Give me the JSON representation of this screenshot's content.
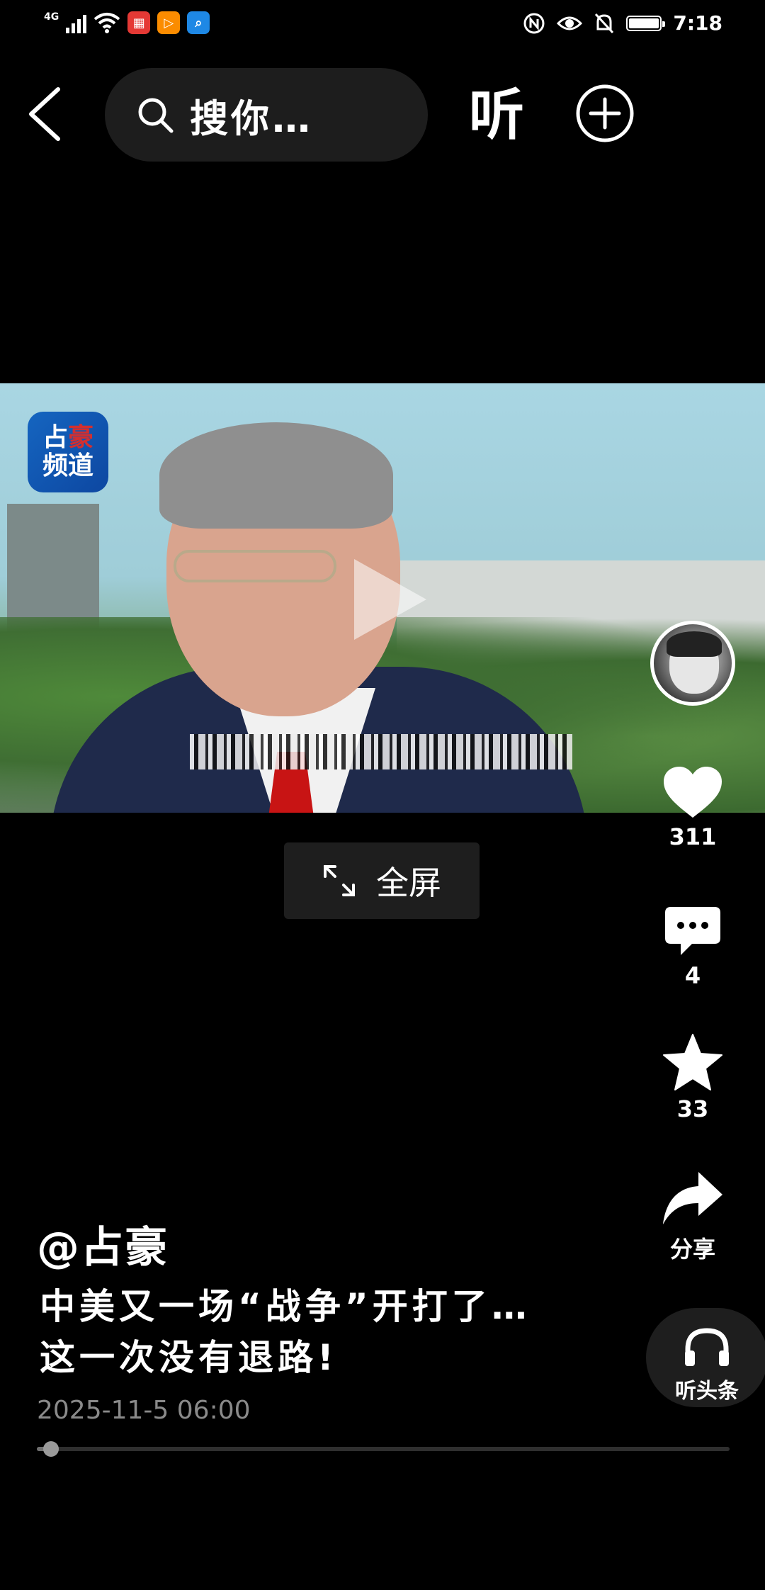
{
  "status_bar": {
    "network": "4G",
    "time": "7:18",
    "icons": [
      "signal-icon",
      "wifi-icon",
      "app-notification-icon",
      "video-app-icon",
      "search-app-icon",
      "nfc-icon",
      "eye-icon",
      "mute-bell-icon",
      "battery-icon"
    ]
  },
  "header": {
    "search_placeholder": "搜你…",
    "listen_label": "听"
  },
  "video": {
    "channel_logo_top": "占",
    "channel_logo_top_red": "豪",
    "channel_logo_bottom": "频道",
    "fullscreen_label": "全屏"
  },
  "actions": {
    "likes": "311",
    "comments": "4",
    "favorites": "33",
    "share_label": "分享",
    "listen_headlines_label": "听头条"
  },
  "post": {
    "author": "@占豪",
    "caption_line1": "中美又一场“战争”开打了…",
    "caption_line2": "这一次没有退路!",
    "date": "2025-11-5 06:00",
    "progress": 0.02
  },
  "colors": {
    "background": "#000000",
    "search_bg": "#1d1d1d",
    "logo_blue": "#1565c0",
    "logo_red": "#d32f2f"
  }
}
